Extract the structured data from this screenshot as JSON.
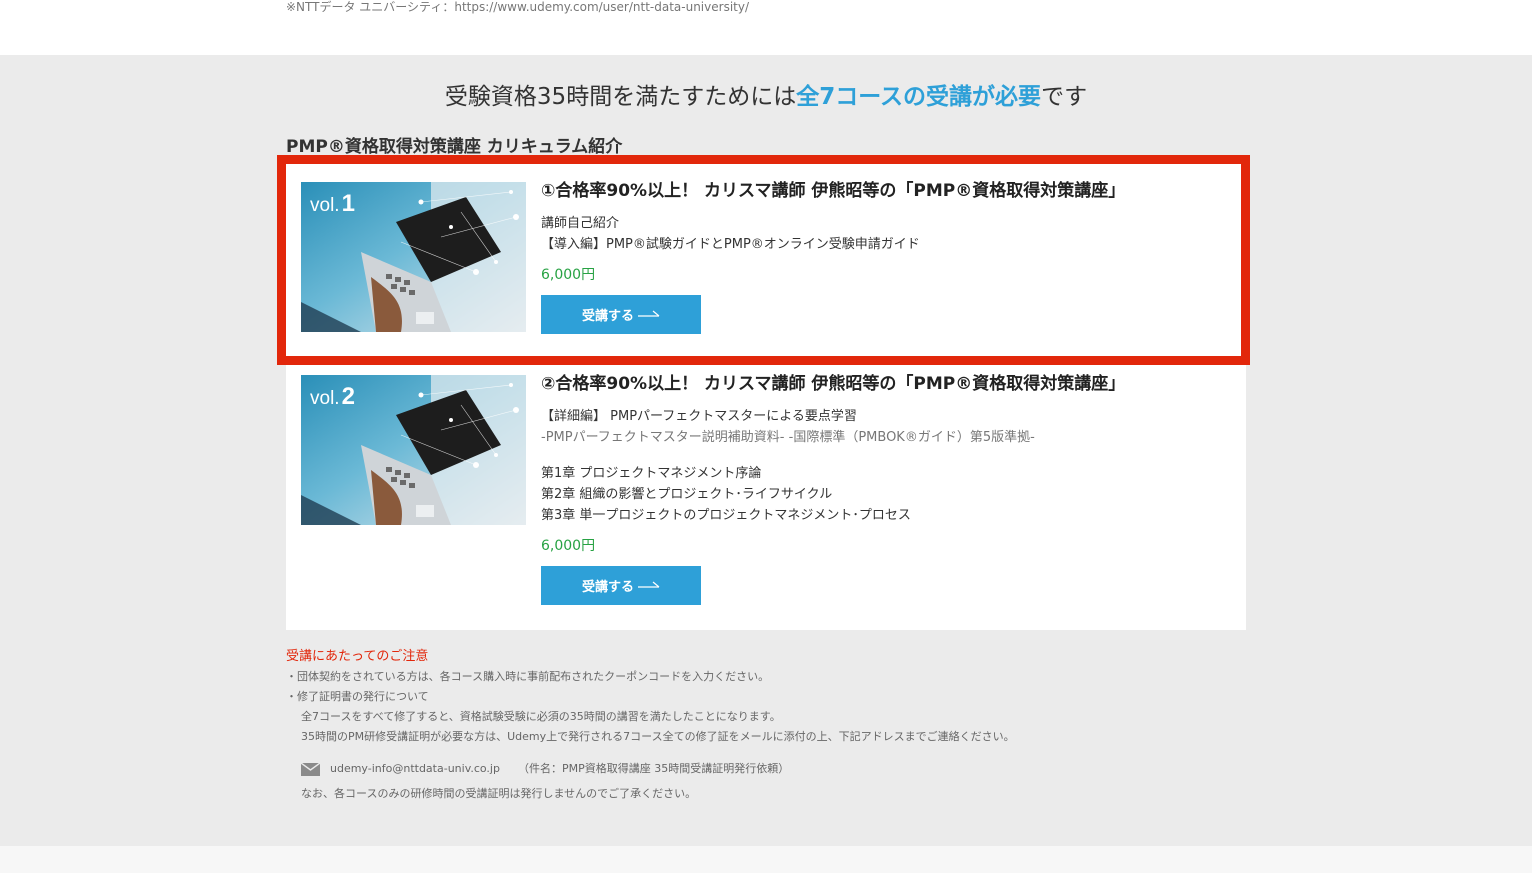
{
  "top_note": "※NTTデータ ユニバーシティ：https://www.udemy.com/user/ntt-data-university/",
  "headline": {
    "before": "受験資格35時間を満たすためには",
    "highlight": "全7コースの受講が必要",
    "after": "です"
  },
  "curriculum_title": "PMP®資格取得対策講座 カリキュラム紹介",
  "courses": [
    {
      "vol_label": "vol.",
      "vol_number": "1",
      "title": "①合格率90%以上！ カリスマ講師 伊熊昭等の「PMP®資格取得対策講座」",
      "lines": [
        "講師自己紹介",
        "【導入編】PMP®試験ガイドとPMP®オンライン受験申請ガイド"
      ],
      "price": "6,000円",
      "button": "受講する"
    },
    {
      "vol_label": "vol.",
      "vol_number": "2",
      "title": "②合格率90%以上！ カリスマ講師 伊熊昭等の「PMP®資格取得対策講座」",
      "lines": [
        "【詳細編】 PMPパーフェクトマスターによる要点学習"
      ],
      "sub_line": "-PMPパーフェクトマスター説明補助資料- -国際標準（PMBOK®ガイド）第5版準拠-",
      "chapters": [
        "第1章 プロジェクトマネジメント序論",
        "第2章 組織の影響とプロジェクト･ライフサイクル",
        "第3章 単一プロジェクトのプロジェクトマネジメント･プロセス"
      ],
      "price": "6,000円",
      "button": "受講する"
    }
  ],
  "notes": {
    "title": "受講にあたってのご注意",
    "lines": [
      "・団体契約をされている方は、各コース購入時に事前配布されたクーポンコードを入力ください。",
      "・修了証明書の発行について"
    ],
    "indented": [
      "全7コースをすべて修了すると、資格試験受験に必須の35時間の講習を満たしたことになります。",
      "35時間のPM研修受講証明が必要な方は、Udemy上で発行される7コース全ての修了証をメールに添付の上、下記アドレスまでご連絡ください。"
    ],
    "email": "udemy-info@nttdata-univ.co.jp",
    "email_subject": "（件名：PMP資格取得講座 35時間受講証明発行依頼）",
    "final": "なお、各コースのみの研修時間の受講証明は発行しませんのでご了承ください。"
  },
  "colors": {
    "accent_blue": "#2ea0d8",
    "price_green": "#27a243",
    "highlight_red": "#e2270b"
  },
  "icons": {
    "button_arrow": "long-arrow-right-icon",
    "mail": "mail-icon"
  }
}
